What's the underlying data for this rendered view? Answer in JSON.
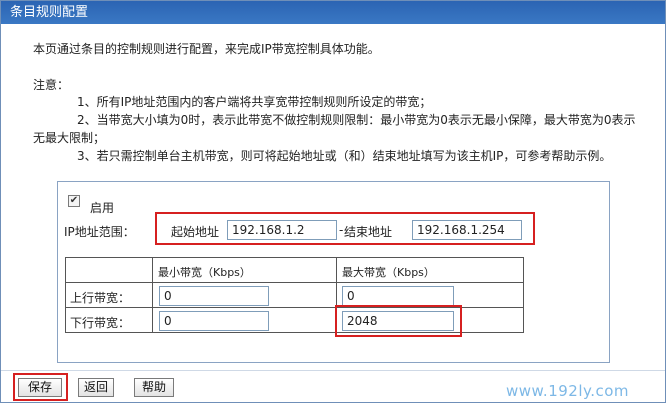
{
  "window": {
    "title": "条目规则配置"
  },
  "intro": "本页通过条目的控制规则进行配置，来完成IP带宽控制具体功能。",
  "notes": {
    "label": "注意：",
    "line1": "1、所有IP地址范围内的客户端将共享宽带控制规则所设定的带宽；",
    "line2a": "2、当带宽大小填为0时，表示此带宽不做控制规则限制：最小带宽为0表示无最小保障，最大带宽为0表示",
    "line2b": "无最大限制；",
    "line3": "3、若只需控制单台主机带宽，则可将起始地址或（和）结束地址填写为该主机IP，可参考帮助示例。"
  },
  "form": {
    "enable_label": "启用",
    "enable_checked": true,
    "ip_range_label": "IP地址范围：",
    "start_label": "起始地址",
    "start_value": "192.168.1.2",
    "separator": "-",
    "end_label": "结束地址",
    "end_value": "192.168.1.254"
  },
  "bandwidth": {
    "min_header": "最小带宽（Kbps）",
    "max_header": "最大带宽（Kbps）",
    "rows": [
      {
        "label": "上行带宽：",
        "min": "0",
        "max": "0"
      },
      {
        "label": "下行带宽：",
        "min": "0",
        "max": "2048"
      }
    ]
  },
  "buttons": {
    "save": "保存",
    "back": "返回",
    "help": "帮助"
  },
  "watermark": "www.192ly.com",
  "colors": {
    "title_bar": "#2b64b3",
    "highlight": "#d62020"
  }
}
